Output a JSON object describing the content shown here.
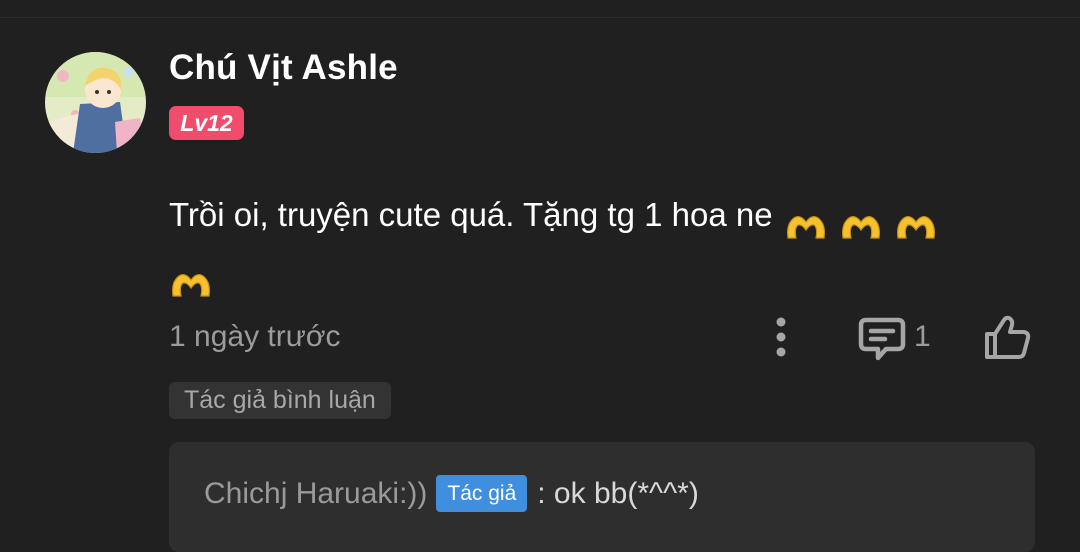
{
  "comment": {
    "username": "Chú Vịt Ashle",
    "level": "Lv12",
    "text": "Trồi oi, truyện cute quá. Tặng tg 1 hoa ne",
    "emoji_icon": "heart-hands-icon",
    "emoji_count": 4,
    "timestamp": "1 ngày trước",
    "reply_count": "1",
    "author_comment_label": "Tác giả bình luận"
  },
  "reply": {
    "author": "Chichj Haruaki:))",
    "badge": "Tác giả",
    "text": ": ok bb(*^^*)"
  },
  "colors": {
    "background": "#202020",
    "level_badge": "#ef4d6b",
    "author_badge": "#3f8fde",
    "muted_text": "#9c9c9c"
  },
  "icons": [
    "more-vertical-icon",
    "reply-comment-icon",
    "thumbs-up-icon",
    "heart-hands-icon"
  ]
}
